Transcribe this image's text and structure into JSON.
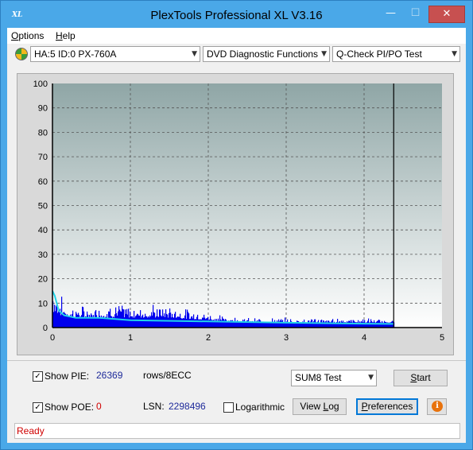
{
  "window": {
    "title": "PlexTools Professional XL V3.16",
    "icon_text": "XL",
    "controls": {
      "minimize": "—",
      "maximize": "☐",
      "close": "✕"
    }
  },
  "menu": {
    "options": {
      "underline": "O",
      "rest": "ptions"
    },
    "help": {
      "underline": "H",
      "rest": "elp"
    }
  },
  "toolbar": {
    "drive": "HA:5 ID:0  PX-760A",
    "function": "DVD Diagnostic Functions",
    "test": "Q-Check PI/PO Test",
    "arrow": "▼"
  },
  "chart_data": {
    "type": "bar",
    "title": "",
    "xlabel": "",
    "ylabel": "",
    "xlim": [
      0,
      5
    ],
    "ylim": [
      0,
      100
    ],
    "x_ticks": [
      "0",
      "1",
      "2",
      "3",
      "4",
      "5"
    ],
    "y_ticks": [
      "0",
      "10",
      "20",
      "30",
      "40",
      "50",
      "60",
      "70",
      "80",
      "90",
      "100"
    ],
    "grid": true,
    "end_marker_x": 4.38,
    "series": [
      {
        "kind": "bars",
        "color": "#0000ee",
        "x": [
          0.0,
          0.1,
          0.2,
          0.3,
          0.4,
          0.5,
          0.6,
          0.7,
          0.8,
          0.9,
          1.0,
          1.2,
          1.5,
          2.0,
          2.5,
          3.0,
          3.5,
          4.0,
          4.38
        ],
        "peak": [
          22,
          13,
          10,
          9,
          9,
          8,
          10,
          11,
          12,
          10,
          9,
          10,
          9,
          6,
          4,
          4,
          4,
          4,
          3
        ],
        "base": [
          6,
          5,
          4,
          4,
          4,
          4,
          4,
          4,
          4,
          4,
          4,
          4,
          4,
          3,
          2,
          2,
          2,
          2,
          2
        ]
      },
      {
        "kind": "line",
        "color": "#22d3e8",
        "x": [
          0.0,
          0.03,
          0.08,
          0.15,
          0.3,
          0.6,
          1.0,
          2.0,
          3.0,
          4.0,
          4.38
        ],
        "values": [
          15,
          13,
          7,
          5,
          4,
          4,
          3,
          2.5,
          2,
          1.6,
          1.5
        ]
      }
    ]
  },
  "bottom": {
    "show_pie": "Show PIE:",
    "pie_value": "26369",
    "rows_label": "rows/8ECC",
    "test_select": "SUM8 Test",
    "start": {
      "underline": "S",
      "rest": "tart"
    },
    "show_poe": "Show POE:",
    "poe_value": "0",
    "lsn_label": "LSN:",
    "lsn_value": "2298496",
    "logarithmic": "Logarithmic",
    "view_log": {
      "pre": "View ",
      "underline": "L",
      "rest": "og"
    },
    "preferences": {
      "underline": "P",
      "rest": "references"
    },
    "info": "i",
    "checkmark": "✓"
  },
  "status": {
    "text": "Ready"
  }
}
